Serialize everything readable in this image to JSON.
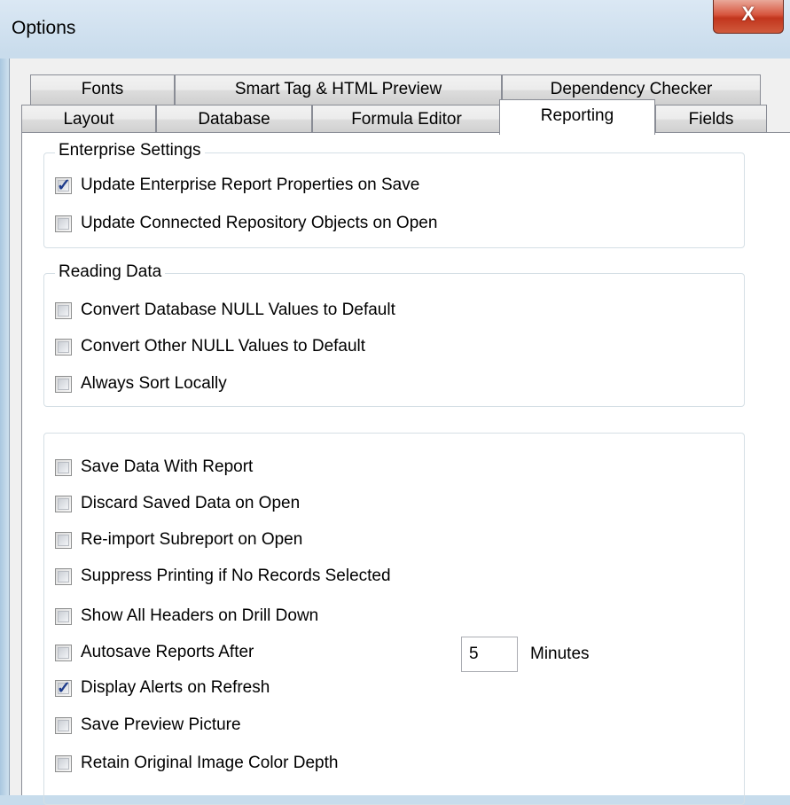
{
  "window": {
    "title": "Options",
    "close_label": "X"
  },
  "tabs_row1": [
    {
      "label": "Fonts"
    },
    {
      "label": "Smart Tag & HTML Preview"
    },
    {
      "label": "Dependency Checker"
    }
  ],
  "tabs_row2": [
    {
      "label": "Layout"
    },
    {
      "label": "Database"
    },
    {
      "label": "Formula Editor"
    },
    {
      "label": "Reporting",
      "active": true
    },
    {
      "label": "Fields"
    }
  ],
  "enterprise": {
    "title": "Enterprise Settings",
    "items": [
      {
        "label": "Update Enterprise Report Properties on Save",
        "checked": true
      },
      {
        "label": "Update Connected Repository Objects on Open",
        "checked": false
      }
    ]
  },
  "reading": {
    "title": "Reading Data",
    "items": [
      {
        "label": "Convert Database NULL Values to Default",
        "checked": false
      },
      {
        "label": "Convert Other NULL Values to Default",
        "checked": false
      },
      {
        "label": "Always Sort Locally",
        "checked": false
      }
    ]
  },
  "general": {
    "items": [
      {
        "label": "Save Data With Report",
        "checked": false
      },
      {
        "label": "Discard Saved Data on Open",
        "checked": false
      },
      {
        "label": "Re-import Subreport on Open",
        "checked": false
      },
      {
        "label": "Suppress Printing if No Records Selected",
        "checked": false
      },
      {
        "label": "Show All Headers on Drill Down",
        "checked": false
      },
      {
        "label": "Autosave Reports After",
        "checked": false
      },
      {
        "label": "Display Alerts on Refresh",
        "checked": true
      },
      {
        "label": "Save Preview Picture",
        "checked": false
      },
      {
        "label": "Retain Original Image Color Depth",
        "checked": false
      }
    ],
    "autosave_minutes_value": "5",
    "autosave_unit": "Minutes"
  }
}
